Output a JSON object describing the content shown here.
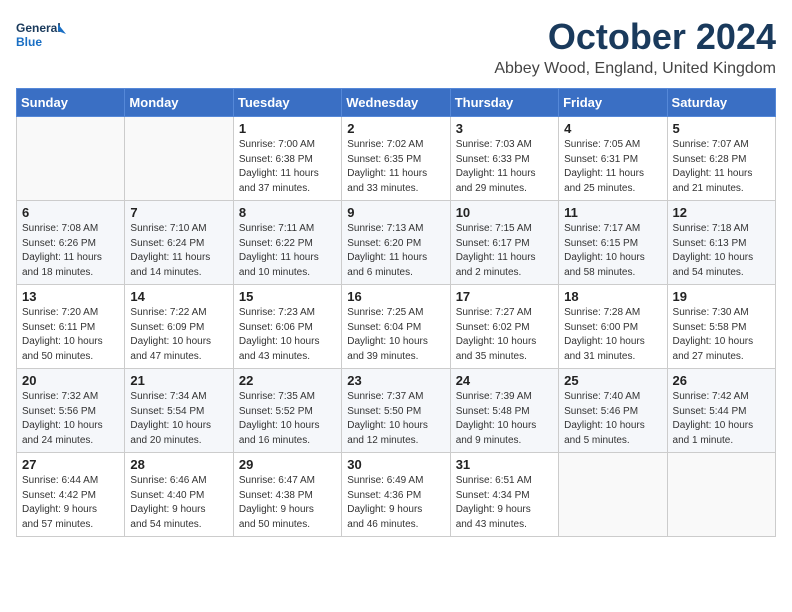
{
  "logo": {
    "general": "General",
    "blue": "Blue"
  },
  "header": {
    "title": "October 2024",
    "subtitle": "Abbey Wood, England, United Kingdom"
  },
  "calendar": {
    "days_of_week": [
      "Sunday",
      "Monday",
      "Tuesday",
      "Wednesday",
      "Thursday",
      "Friday",
      "Saturday"
    ],
    "weeks": [
      [
        {
          "day": "",
          "info": ""
        },
        {
          "day": "",
          "info": ""
        },
        {
          "day": "1",
          "info": "Sunrise: 7:00 AM\nSunset: 6:38 PM\nDaylight: 11 hours\nand 37 minutes."
        },
        {
          "day": "2",
          "info": "Sunrise: 7:02 AM\nSunset: 6:35 PM\nDaylight: 11 hours\nand 33 minutes."
        },
        {
          "day": "3",
          "info": "Sunrise: 7:03 AM\nSunset: 6:33 PM\nDaylight: 11 hours\nand 29 minutes."
        },
        {
          "day": "4",
          "info": "Sunrise: 7:05 AM\nSunset: 6:31 PM\nDaylight: 11 hours\nand 25 minutes."
        },
        {
          "day": "5",
          "info": "Sunrise: 7:07 AM\nSunset: 6:28 PM\nDaylight: 11 hours\nand 21 minutes."
        }
      ],
      [
        {
          "day": "6",
          "info": "Sunrise: 7:08 AM\nSunset: 6:26 PM\nDaylight: 11 hours\nand 18 minutes."
        },
        {
          "day": "7",
          "info": "Sunrise: 7:10 AM\nSunset: 6:24 PM\nDaylight: 11 hours\nand 14 minutes."
        },
        {
          "day": "8",
          "info": "Sunrise: 7:11 AM\nSunset: 6:22 PM\nDaylight: 11 hours\nand 10 minutes."
        },
        {
          "day": "9",
          "info": "Sunrise: 7:13 AM\nSunset: 6:20 PM\nDaylight: 11 hours\nand 6 minutes."
        },
        {
          "day": "10",
          "info": "Sunrise: 7:15 AM\nSunset: 6:17 PM\nDaylight: 11 hours\nand 2 minutes."
        },
        {
          "day": "11",
          "info": "Sunrise: 7:17 AM\nSunset: 6:15 PM\nDaylight: 10 hours\nand 58 minutes."
        },
        {
          "day": "12",
          "info": "Sunrise: 7:18 AM\nSunset: 6:13 PM\nDaylight: 10 hours\nand 54 minutes."
        }
      ],
      [
        {
          "day": "13",
          "info": "Sunrise: 7:20 AM\nSunset: 6:11 PM\nDaylight: 10 hours\nand 50 minutes."
        },
        {
          "day": "14",
          "info": "Sunrise: 7:22 AM\nSunset: 6:09 PM\nDaylight: 10 hours\nand 47 minutes."
        },
        {
          "day": "15",
          "info": "Sunrise: 7:23 AM\nSunset: 6:06 PM\nDaylight: 10 hours\nand 43 minutes."
        },
        {
          "day": "16",
          "info": "Sunrise: 7:25 AM\nSunset: 6:04 PM\nDaylight: 10 hours\nand 39 minutes."
        },
        {
          "day": "17",
          "info": "Sunrise: 7:27 AM\nSunset: 6:02 PM\nDaylight: 10 hours\nand 35 minutes."
        },
        {
          "day": "18",
          "info": "Sunrise: 7:28 AM\nSunset: 6:00 PM\nDaylight: 10 hours\nand 31 minutes."
        },
        {
          "day": "19",
          "info": "Sunrise: 7:30 AM\nSunset: 5:58 PM\nDaylight: 10 hours\nand 27 minutes."
        }
      ],
      [
        {
          "day": "20",
          "info": "Sunrise: 7:32 AM\nSunset: 5:56 PM\nDaylight: 10 hours\nand 24 minutes."
        },
        {
          "day": "21",
          "info": "Sunrise: 7:34 AM\nSunset: 5:54 PM\nDaylight: 10 hours\nand 20 minutes."
        },
        {
          "day": "22",
          "info": "Sunrise: 7:35 AM\nSunset: 5:52 PM\nDaylight: 10 hours\nand 16 minutes."
        },
        {
          "day": "23",
          "info": "Sunrise: 7:37 AM\nSunset: 5:50 PM\nDaylight: 10 hours\nand 12 minutes."
        },
        {
          "day": "24",
          "info": "Sunrise: 7:39 AM\nSunset: 5:48 PM\nDaylight: 10 hours\nand 9 minutes."
        },
        {
          "day": "25",
          "info": "Sunrise: 7:40 AM\nSunset: 5:46 PM\nDaylight: 10 hours\nand 5 minutes."
        },
        {
          "day": "26",
          "info": "Sunrise: 7:42 AM\nSunset: 5:44 PM\nDaylight: 10 hours\nand 1 minute."
        }
      ],
      [
        {
          "day": "27",
          "info": "Sunrise: 6:44 AM\nSunset: 4:42 PM\nDaylight: 9 hours\nand 57 minutes."
        },
        {
          "day": "28",
          "info": "Sunrise: 6:46 AM\nSunset: 4:40 PM\nDaylight: 9 hours\nand 54 minutes."
        },
        {
          "day": "29",
          "info": "Sunrise: 6:47 AM\nSunset: 4:38 PM\nDaylight: 9 hours\nand 50 minutes."
        },
        {
          "day": "30",
          "info": "Sunrise: 6:49 AM\nSunset: 4:36 PM\nDaylight: 9 hours\nand 46 minutes."
        },
        {
          "day": "31",
          "info": "Sunrise: 6:51 AM\nSunset: 4:34 PM\nDaylight: 9 hours\nand 43 minutes."
        },
        {
          "day": "",
          "info": ""
        },
        {
          "day": "",
          "info": ""
        }
      ]
    ]
  }
}
